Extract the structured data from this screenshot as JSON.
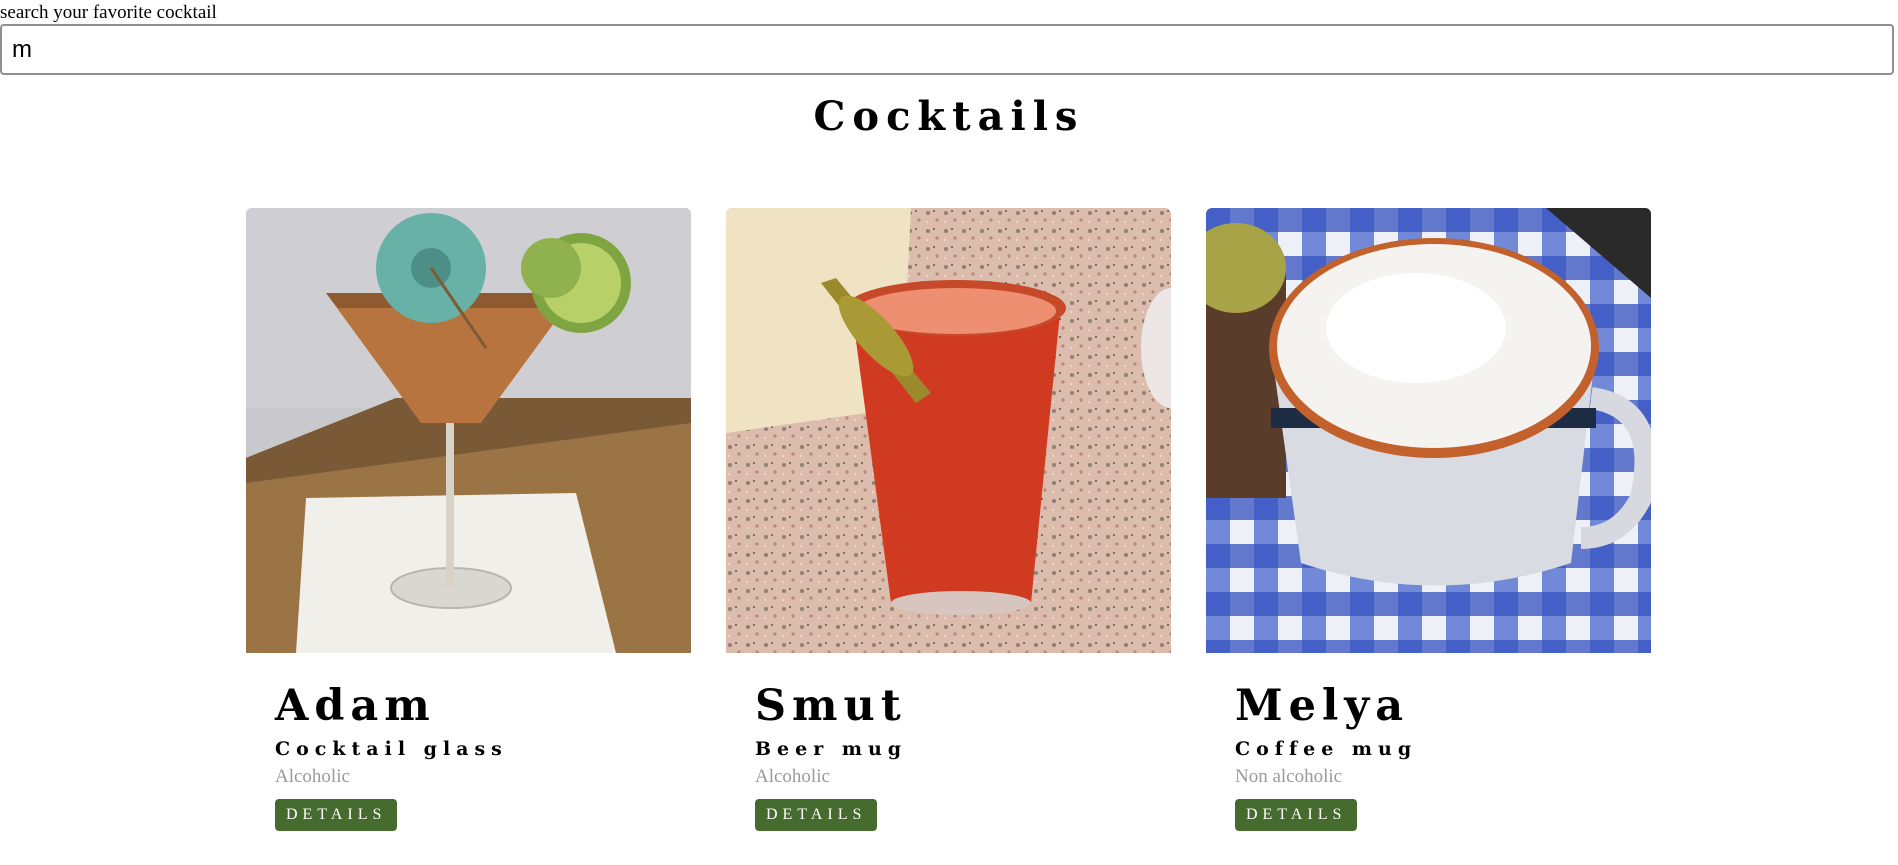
{
  "search": {
    "label": "search your favorite cocktail",
    "value": "m"
  },
  "page": {
    "title": "Cocktails"
  },
  "cocktails": [
    {
      "name": "Adam",
      "glass": "Cocktail glass",
      "type": "Alcoholic",
      "button_label": "DETAILS",
      "image": "martini-glass-with-lime-and-umbrella-photo"
    },
    {
      "name": "Smut",
      "glass": "Beer mug",
      "type": "Alcoholic",
      "button_label": "DETAILS",
      "image": "red-drink-with-okra-garnish-photo"
    },
    {
      "name": "Melya",
      "glass": "Coffee mug",
      "type": "Non alcoholic",
      "button_label": "DETAILS",
      "image": "frothy-coffee-mug-on-checkered-cloth-photo"
    }
  ],
  "colors": {
    "button_bg": "#456b2f",
    "muted_text": "#9a9a9a"
  }
}
